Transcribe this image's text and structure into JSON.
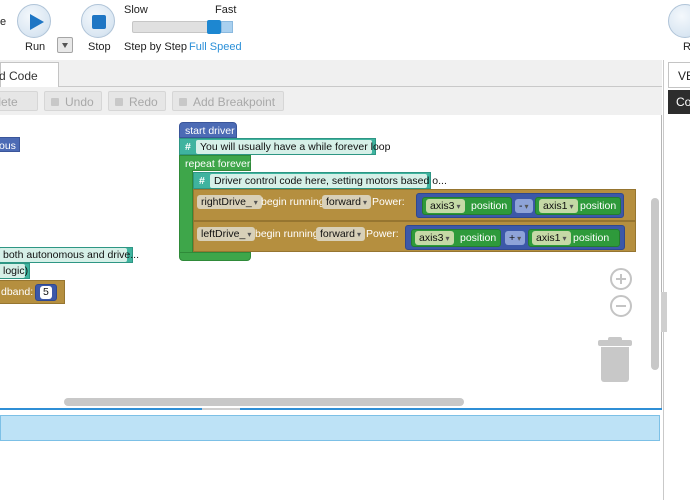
{
  "toolbar": {
    "cut_label": "e",
    "run_label": "Run",
    "stop_label": "Stop",
    "slow_label": "Slow",
    "fast_label": "Fast",
    "step_label": "Step by Step",
    "full_speed_label": "Full Speed",
    "right_cut_label": "R",
    "speed_value": 0.85
  },
  "tabs": {
    "code_tab": "d Code",
    "ve_tab": "VE",
    "co_tab": "Co"
  },
  "actions": {
    "delete": "Delete",
    "undo": "Undo",
    "redo": "Redo",
    "add_breakpoint": "Add Breakpoint"
  },
  "left_blocks": {
    "ous": "ous",
    "both_autonomous": "both autonomous and drive...",
    "logic": "logic)",
    "deadband": "dband:",
    "deadband_value": "5"
  },
  "driver": {
    "start": "start driver",
    "comment1": "You will usually have a while forever loop",
    "repeat": "repeat forever",
    "comment2": "Driver control code here, setting motors based o...",
    "right_motor": "rightDrive_",
    "left_motor": "leftDrive_",
    "begin_running": "begin running",
    "direction": "forward",
    "power": "Power:",
    "axis3": "axis3",
    "axis1": "axis1",
    "position": "position",
    "minus": "-",
    "plus": "+"
  },
  "colors": {
    "accent": "#1f76c4",
    "teal_block": "#3fb39f",
    "blue_block": "#4c6bb5",
    "green_block": "#3ea64a",
    "brown_block": "#b58f3f"
  }
}
